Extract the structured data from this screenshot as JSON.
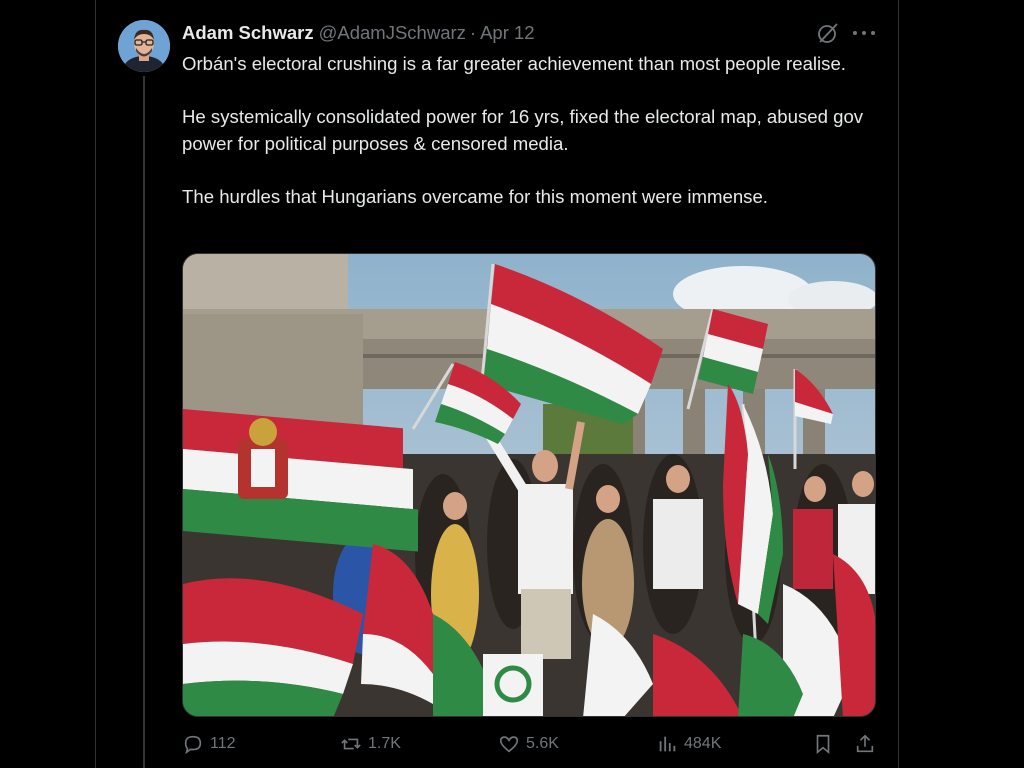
{
  "tweet": {
    "author_name": "Adam Schwarz",
    "author_handle": "@AdamJSchwarz",
    "separator": "·",
    "date": "Apr 12",
    "paragraphs": [
      "Orbán's electoral crushing is a far greater achievement than most people realise.",
      "He systemically consolidated power for 16 yrs, fixed the electoral map, abused gov power for political purposes & censored media.",
      "The hurdles that Hungarians overcame for this moment were immense."
    ],
    "media_icon": "photo-rally-hungarian-flags"
  },
  "actions": {
    "replies": "112",
    "reposts": "1.7K",
    "likes": "5.6K",
    "views": "484K"
  },
  "icons": {
    "reply": "reply-icon",
    "repost": "repost-icon",
    "like": "like-icon",
    "views": "views-icon",
    "bookmark": "bookmark-icon",
    "share": "share-icon",
    "grok": "grok-icon",
    "more": "more-icon"
  },
  "colors": {
    "background": "#000000",
    "text": "#e7e9ea",
    "muted": "#71767b",
    "border": "#2f3336",
    "flag_red": "#c8283a",
    "flag_white": "#f3f3f3",
    "flag_green": "#2f8a45"
  }
}
